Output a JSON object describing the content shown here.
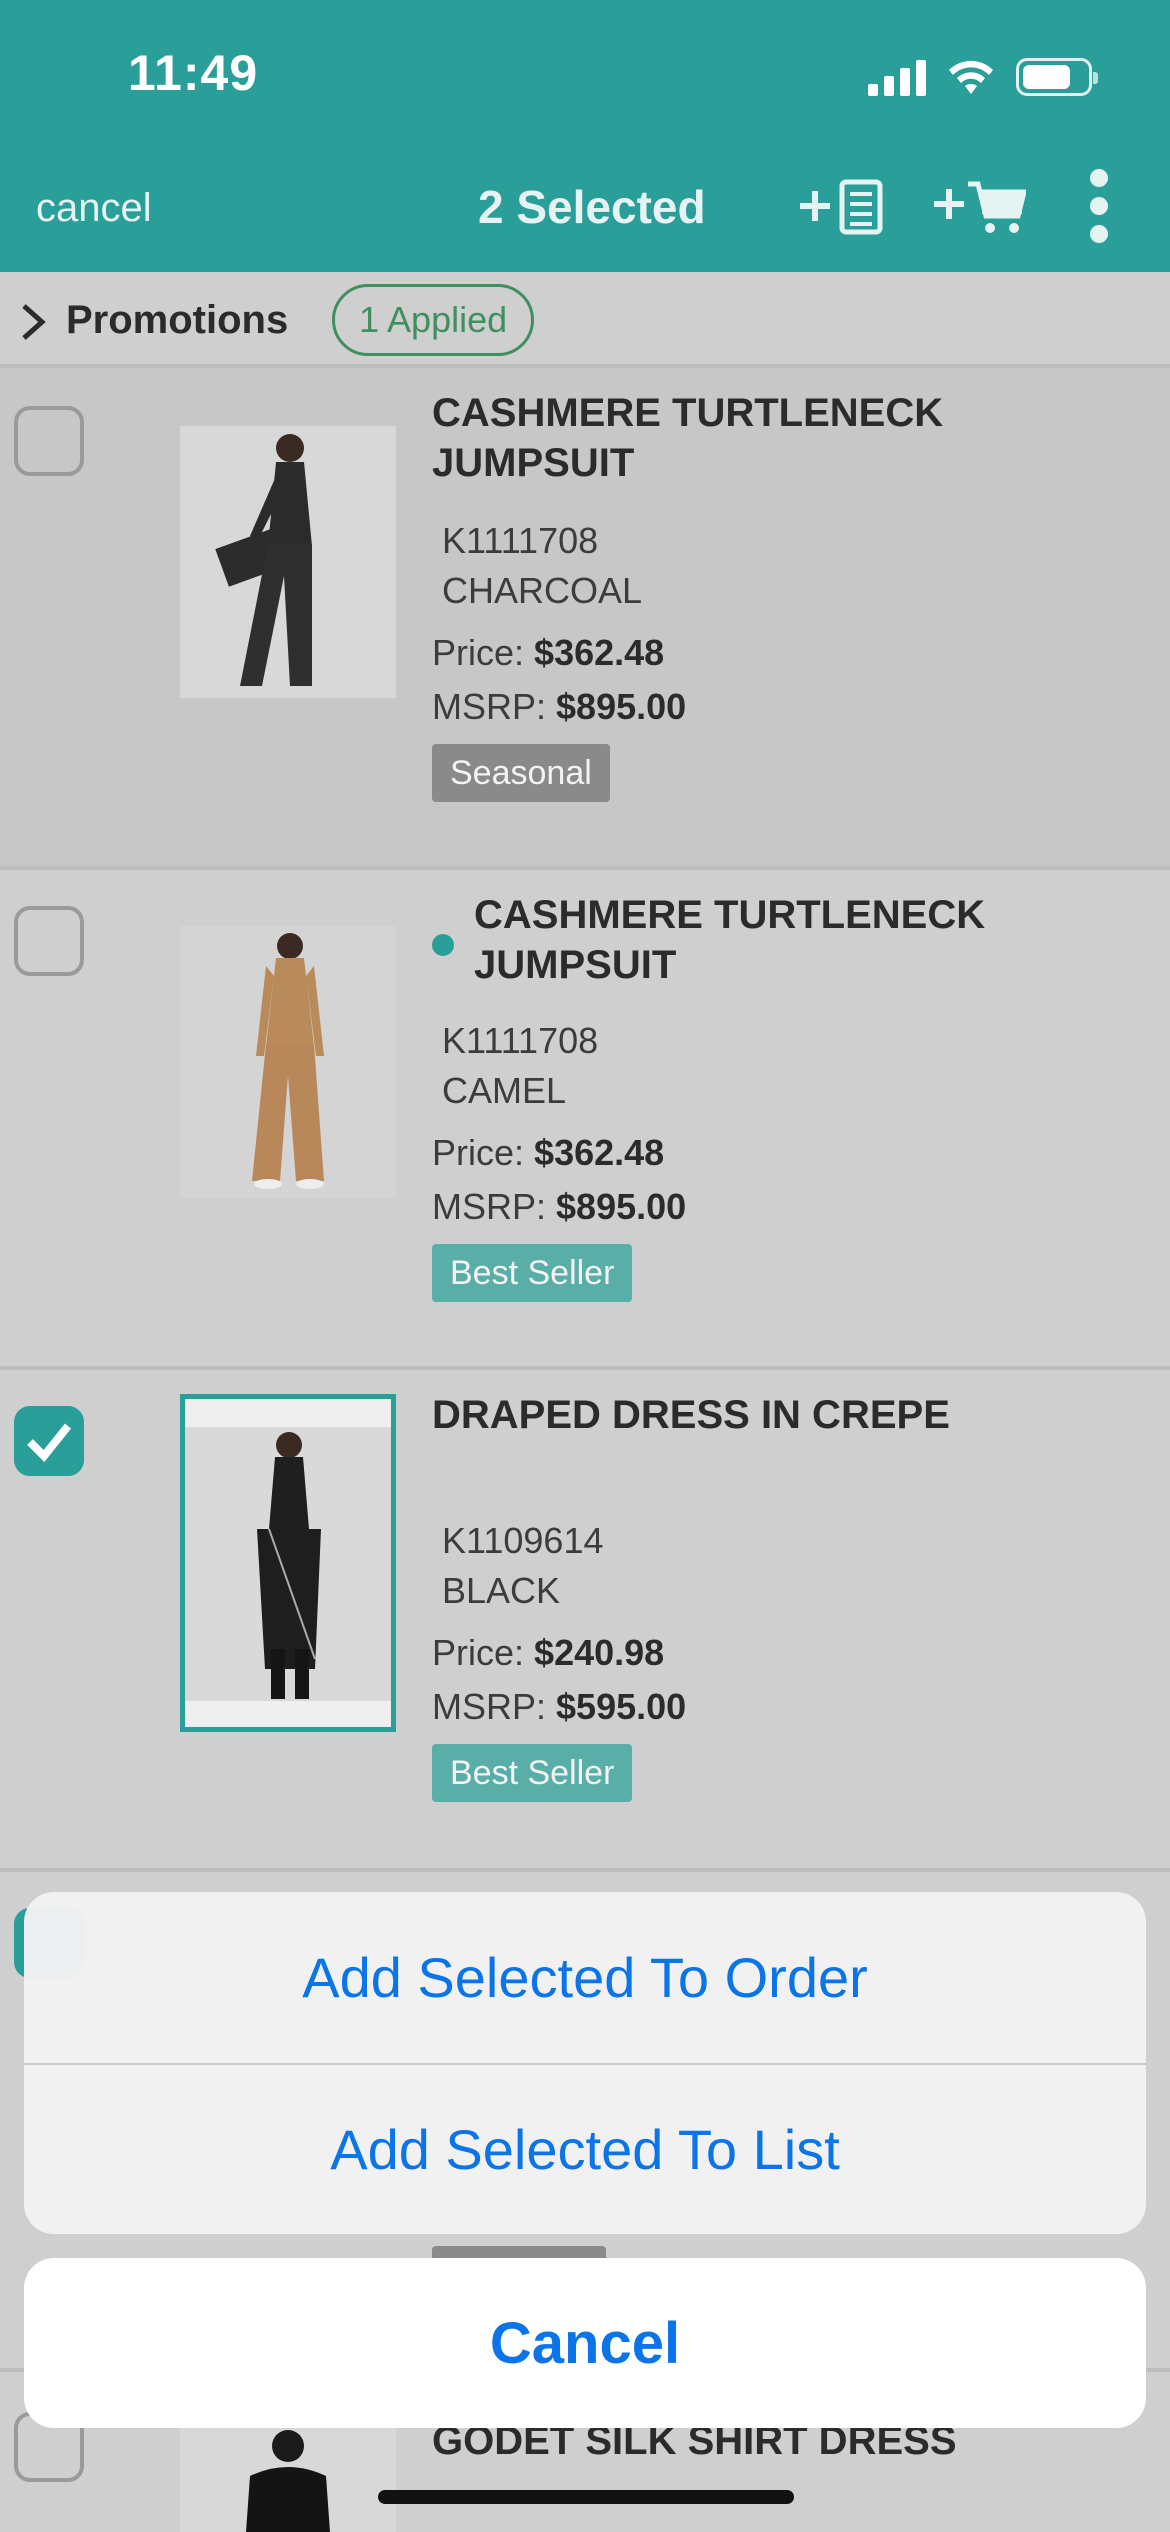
{
  "status": {
    "time": "11:49"
  },
  "nav": {
    "cancel_label": "cancel",
    "title": "2 Selected"
  },
  "promotions": {
    "label": "Promotions",
    "badge": "1 Applied"
  },
  "products": [
    {
      "name": "CASHMERE TURTLENECK JUMPSUIT",
      "sku": "K1111708",
      "color": "CHARCOAL",
      "price_label": "Price:",
      "price": "$362.48",
      "msrp_label": "MSRP:",
      "msrp": "$895.00",
      "tag": "Seasonal",
      "checked": false
    },
    {
      "name": "CASHMERE TURTLENECK JUMPSUIT",
      "sku": "K1111708",
      "color": "CAMEL",
      "price_label": "Price:",
      "price": "$362.48",
      "msrp_label": "MSRP:",
      "msrp": "$895.00",
      "tag": "Best Seller",
      "checked": false
    },
    {
      "name": "DRAPED DRESS IN CREPE",
      "sku": "K1109614",
      "color": "BLACK",
      "price_label": "Price:",
      "price": "$240.98",
      "msrp_label": "MSRP:",
      "msrp": "$595.00",
      "tag": "Best Seller",
      "checked": true
    },
    {
      "name": "GODET SILK SHIRT DRESS",
      "checked": false
    }
  ],
  "action_sheet": {
    "add_to_order": "Add Selected To Order",
    "add_to_list": "Add Selected To List",
    "cancel": "Cancel"
  },
  "colors": {
    "accent": "#2a9e98",
    "tag_seasonal": "#8a8a8a",
    "tag_best_seller": "#5aaea8",
    "action_blue": "#0a74e8"
  }
}
